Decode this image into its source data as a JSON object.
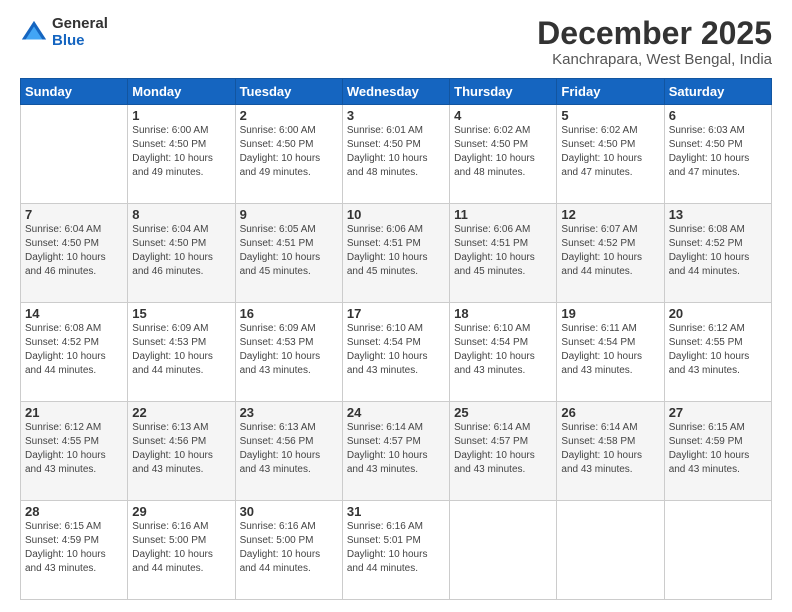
{
  "logo": {
    "general": "General",
    "blue": "Blue"
  },
  "header": {
    "month": "December 2025",
    "location": "Kanchrapara, West Bengal, India"
  },
  "weekdays": [
    "Sunday",
    "Monday",
    "Tuesday",
    "Wednesday",
    "Thursday",
    "Friday",
    "Saturday"
  ],
  "weeks": [
    [
      {
        "day": "",
        "info": ""
      },
      {
        "day": "1",
        "info": "Sunrise: 6:00 AM\nSunset: 4:50 PM\nDaylight: 10 hours\nand 49 minutes."
      },
      {
        "day": "2",
        "info": "Sunrise: 6:00 AM\nSunset: 4:50 PM\nDaylight: 10 hours\nand 49 minutes."
      },
      {
        "day": "3",
        "info": "Sunrise: 6:01 AM\nSunset: 4:50 PM\nDaylight: 10 hours\nand 48 minutes."
      },
      {
        "day": "4",
        "info": "Sunrise: 6:02 AM\nSunset: 4:50 PM\nDaylight: 10 hours\nand 48 minutes."
      },
      {
        "day": "5",
        "info": "Sunrise: 6:02 AM\nSunset: 4:50 PM\nDaylight: 10 hours\nand 47 minutes."
      },
      {
        "day": "6",
        "info": "Sunrise: 6:03 AM\nSunset: 4:50 PM\nDaylight: 10 hours\nand 47 minutes."
      }
    ],
    [
      {
        "day": "7",
        "info": "Sunrise: 6:04 AM\nSunset: 4:50 PM\nDaylight: 10 hours\nand 46 minutes."
      },
      {
        "day": "8",
        "info": "Sunrise: 6:04 AM\nSunset: 4:50 PM\nDaylight: 10 hours\nand 46 minutes."
      },
      {
        "day": "9",
        "info": "Sunrise: 6:05 AM\nSunset: 4:51 PM\nDaylight: 10 hours\nand 45 minutes."
      },
      {
        "day": "10",
        "info": "Sunrise: 6:06 AM\nSunset: 4:51 PM\nDaylight: 10 hours\nand 45 minutes."
      },
      {
        "day": "11",
        "info": "Sunrise: 6:06 AM\nSunset: 4:51 PM\nDaylight: 10 hours\nand 45 minutes."
      },
      {
        "day": "12",
        "info": "Sunrise: 6:07 AM\nSunset: 4:52 PM\nDaylight: 10 hours\nand 44 minutes."
      },
      {
        "day": "13",
        "info": "Sunrise: 6:08 AM\nSunset: 4:52 PM\nDaylight: 10 hours\nand 44 minutes."
      }
    ],
    [
      {
        "day": "14",
        "info": "Sunrise: 6:08 AM\nSunset: 4:52 PM\nDaylight: 10 hours\nand 44 minutes."
      },
      {
        "day": "15",
        "info": "Sunrise: 6:09 AM\nSunset: 4:53 PM\nDaylight: 10 hours\nand 44 minutes."
      },
      {
        "day": "16",
        "info": "Sunrise: 6:09 AM\nSunset: 4:53 PM\nDaylight: 10 hours\nand 43 minutes."
      },
      {
        "day": "17",
        "info": "Sunrise: 6:10 AM\nSunset: 4:54 PM\nDaylight: 10 hours\nand 43 minutes."
      },
      {
        "day": "18",
        "info": "Sunrise: 6:10 AM\nSunset: 4:54 PM\nDaylight: 10 hours\nand 43 minutes."
      },
      {
        "day": "19",
        "info": "Sunrise: 6:11 AM\nSunset: 4:54 PM\nDaylight: 10 hours\nand 43 minutes."
      },
      {
        "day": "20",
        "info": "Sunrise: 6:12 AM\nSunset: 4:55 PM\nDaylight: 10 hours\nand 43 minutes."
      }
    ],
    [
      {
        "day": "21",
        "info": "Sunrise: 6:12 AM\nSunset: 4:55 PM\nDaylight: 10 hours\nand 43 minutes."
      },
      {
        "day": "22",
        "info": "Sunrise: 6:13 AM\nSunset: 4:56 PM\nDaylight: 10 hours\nand 43 minutes."
      },
      {
        "day": "23",
        "info": "Sunrise: 6:13 AM\nSunset: 4:56 PM\nDaylight: 10 hours\nand 43 minutes."
      },
      {
        "day": "24",
        "info": "Sunrise: 6:14 AM\nSunset: 4:57 PM\nDaylight: 10 hours\nand 43 minutes."
      },
      {
        "day": "25",
        "info": "Sunrise: 6:14 AM\nSunset: 4:57 PM\nDaylight: 10 hours\nand 43 minutes."
      },
      {
        "day": "26",
        "info": "Sunrise: 6:14 AM\nSunset: 4:58 PM\nDaylight: 10 hours\nand 43 minutes."
      },
      {
        "day": "27",
        "info": "Sunrise: 6:15 AM\nSunset: 4:59 PM\nDaylight: 10 hours\nand 43 minutes."
      }
    ],
    [
      {
        "day": "28",
        "info": "Sunrise: 6:15 AM\nSunset: 4:59 PM\nDaylight: 10 hours\nand 43 minutes."
      },
      {
        "day": "29",
        "info": "Sunrise: 6:16 AM\nSunset: 5:00 PM\nDaylight: 10 hours\nand 44 minutes."
      },
      {
        "day": "30",
        "info": "Sunrise: 6:16 AM\nSunset: 5:00 PM\nDaylight: 10 hours\nand 44 minutes."
      },
      {
        "day": "31",
        "info": "Sunrise: 6:16 AM\nSunset: 5:01 PM\nDaylight: 10 hours\nand 44 minutes."
      },
      {
        "day": "",
        "info": ""
      },
      {
        "day": "",
        "info": ""
      },
      {
        "day": "",
        "info": ""
      }
    ]
  ]
}
